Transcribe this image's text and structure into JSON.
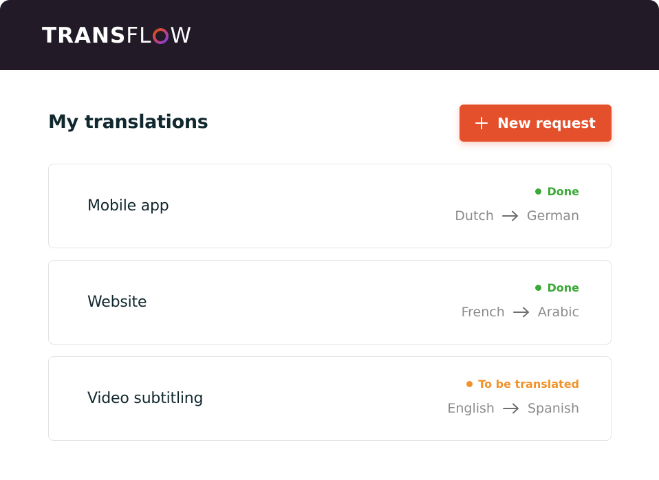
{
  "brand": {
    "part1": "TRANS",
    "part2_before_o": "FL",
    "part2_after_o": "W",
    "colors": {
      "header_bg": "#221a27",
      "o_orange": "#e4502b",
      "o_purple": "#7b3fe4"
    }
  },
  "page": {
    "title": "My translations"
  },
  "toolbar": {
    "new_request_label": "New request",
    "new_request_icon": "plus-icon",
    "accent": "#e4502b"
  },
  "translations": [
    {
      "title": "Mobile app",
      "status": "Done",
      "status_color": "#3aa935",
      "source": "Dutch",
      "target": "German"
    },
    {
      "title": "Website",
      "status": "Done",
      "status_color": "#3aa935",
      "source": "French",
      "target": "Arabic"
    },
    {
      "title": "Video subtitling",
      "status": "To be translated",
      "status_color": "#f0922b",
      "source": "English",
      "target": "Spanish"
    }
  ]
}
